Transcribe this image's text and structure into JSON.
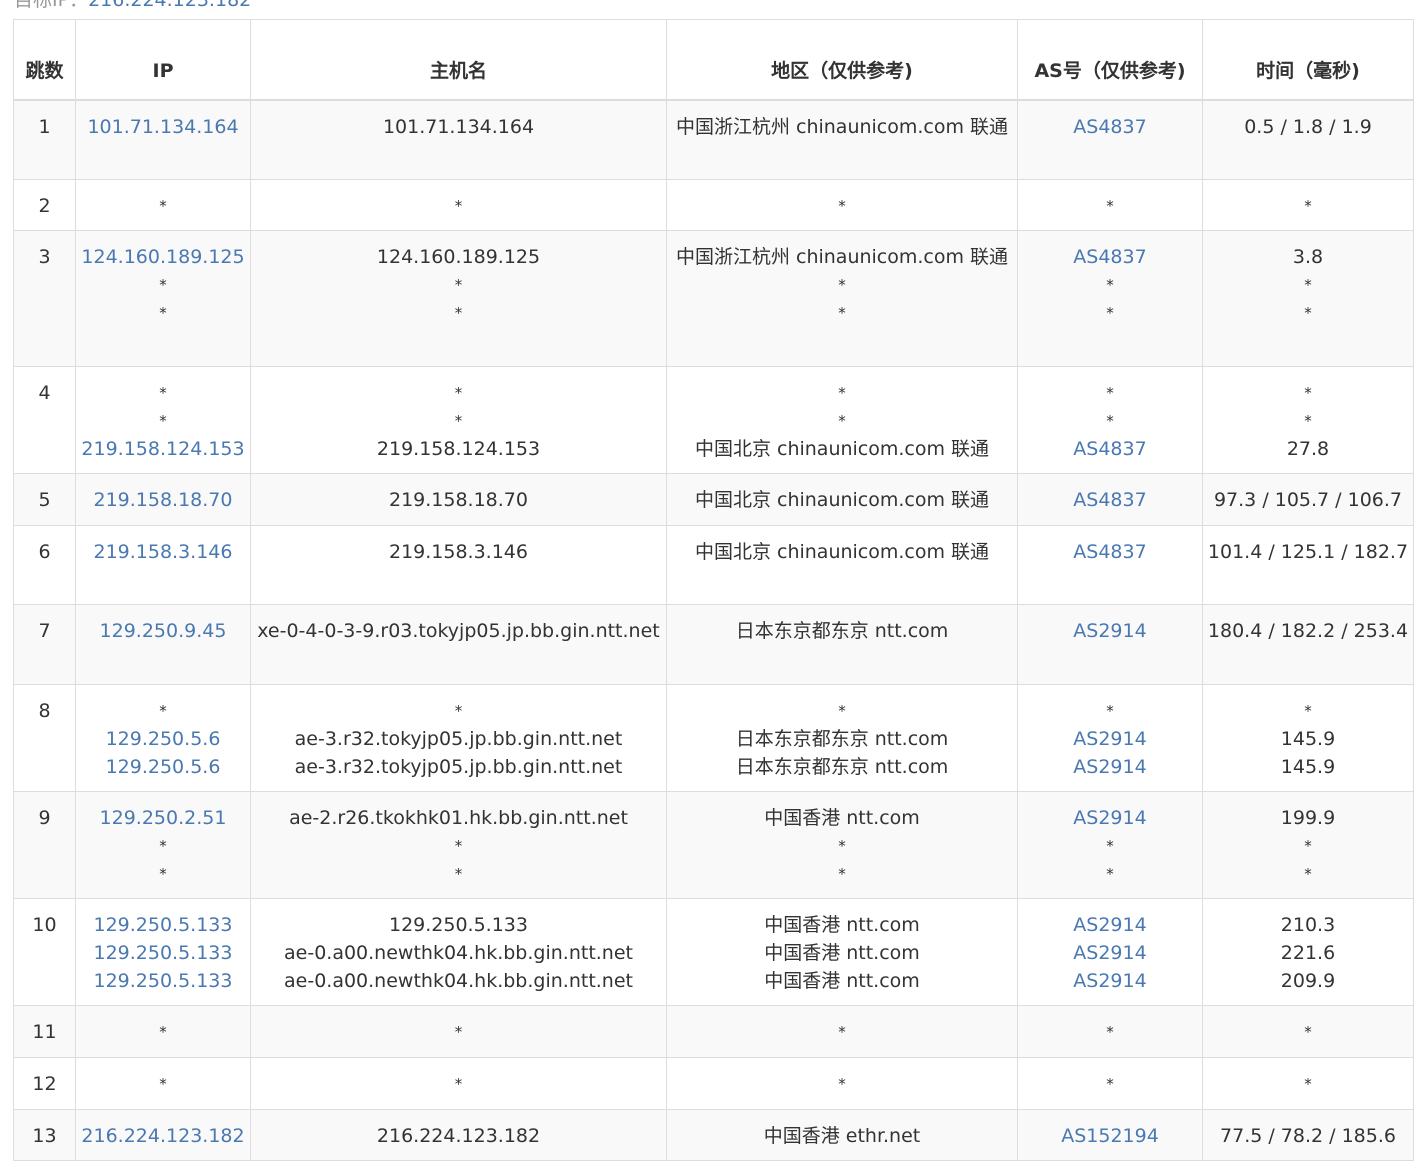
{
  "target": {
    "label": "目标IP：",
    "ip": "216.224.123.182"
  },
  "headers": [
    "跳数",
    "IP",
    "主机名",
    "地区（仅供参考)",
    "AS号（仅供参考)",
    "时间（毫秒)"
  ],
  "rows": [
    {
      "hop": "1",
      "ip": [
        "101.71.134.164"
      ],
      "host": [
        "101.71.134.164"
      ],
      "region": [
        "中国浙江杭州 chinaunicom.com 联通"
      ],
      "as": [
        "AS4837"
      ],
      "time": [
        "0.5 / 1.8 / 1.9"
      ]
    },
    {
      "hop": "2",
      "ip": [
        "*"
      ],
      "host": [
        "*"
      ],
      "region": [
        "*"
      ],
      "as": [
        "*"
      ],
      "time": [
        "*"
      ]
    },
    {
      "hop": "3",
      "ip": [
        "124.160.189.125",
        "*",
        "*"
      ],
      "host": [
        "124.160.189.125",
        "*",
        "*"
      ],
      "region": [
        "中国浙江杭州 chinaunicom.com 联通",
        "*",
        "*"
      ],
      "as": [
        "AS4837",
        "*",
        "*"
      ],
      "time": [
        "3.8",
        "*",
        "*"
      ]
    },
    {
      "hop": "4",
      "ip": [
        "*",
        "*",
        "219.158.124.153"
      ],
      "host": [
        "*",
        "*",
        "219.158.124.153"
      ],
      "region": [
        "*",
        "*",
        "中国北京 chinaunicom.com 联通"
      ],
      "as": [
        "*",
        "*",
        "AS4837"
      ],
      "time": [
        "*",
        "*",
        "27.8"
      ]
    },
    {
      "hop": "5",
      "ip": [
        "219.158.18.70"
      ],
      "host": [
        "219.158.18.70"
      ],
      "region": [
        "中国北京 chinaunicom.com 联通"
      ],
      "as": [
        "AS4837"
      ],
      "time": [
        "97.3 / 105.7 / 106.7"
      ]
    },
    {
      "hop": "6",
      "ip": [
        "219.158.3.146"
      ],
      "host": [
        "219.158.3.146"
      ],
      "region": [
        "中国北京 chinaunicom.com 联通"
      ],
      "as": [
        "AS4837"
      ],
      "time": [
        "101.4 / 125.1 / 182.7"
      ]
    },
    {
      "hop": "7",
      "ip": [
        "129.250.9.45"
      ],
      "host": [
        "xe-0-4-0-3-9.r03.tokyjp05.jp.bb.gin.ntt.net"
      ],
      "region": [
        "日本东京都东京 ntt.com"
      ],
      "as": [
        "AS2914"
      ],
      "time": [
        "180.4 / 182.2 / 253.4"
      ]
    },
    {
      "hop": "8",
      "ip": [
        "*",
        "129.250.5.6",
        "129.250.5.6"
      ],
      "host": [
        "*",
        "ae-3.r32.tokyjp05.jp.bb.gin.ntt.net",
        "ae-3.r32.tokyjp05.jp.bb.gin.ntt.net"
      ],
      "region": [
        "*",
        "日本东京都东京 ntt.com",
        "日本东京都东京 ntt.com"
      ],
      "as": [
        "*",
        "AS2914",
        "AS2914"
      ],
      "time": [
        "*",
        "145.9",
        "145.9"
      ]
    },
    {
      "hop": "9",
      "ip": [
        "129.250.2.51",
        "*",
        "*"
      ],
      "host": [
        "ae-2.r26.tkokhk01.hk.bb.gin.ntt.net",
        "*",
        "*"
      ],
      "region": [
        "中国香港 ntt.com",
        "*",
        "*"
      ],
      "as": [
        "AS2914",
        "*",
        "*"
      ],
      "time": [
        "199.9",
        "*",
        "*"
      ]
    },
    {
      "hop": "10",
      "ip": [
        "129.250.5.133",
        "129.250.5.133",
        "129.250.5.133"
      ],
      "host": [
        "129.250.5.133",
        "ae-0.a00.newthk04.hk.bb.gin.ntt.net",
        "ae-0.a00.newthk04.hk.bb.gin.ntt.net"
      ],
      "region": [
        "中国香港 ntt.com",
        "中国香港 ntt.com",
        "中国香港 ntt.com"
      ],
      "as": [
        "AS2914",
        "AS2914",
        "AS2914"
      ],
      "time": [
        "210.3",
        "221.6",
        "209.9"
      ]
    },
    {
      "hop": "11",
      "ip": [
        "*"
      ],
      "host": [
        "*"
      ],
      "region": [
        "*"
      ],
      "as": [
        "*"
      ],
      "time": [
        "*"
      ]
    },
    {
      "hop": "12",
      "ip": [
        "*"
      ],
      "host": [
        "*"
      ],
      "region": [
        "*"
      ],
      "as": [
        "*"
      ],
      "time": [
        "*"
      ]
    },
    {
      "hop": "13",
      "ip": [
        "216.224.123.182"
      ],
      "host": [
        "216.224.123.182"
      ],
      "region": [
        "中国香港 ethr.net"
      ],
      "as": [
        "AS152194"
      ],
      "time": [
        "77.5 / 78.2 / 185.6"
      ]
    }
  ]
}
